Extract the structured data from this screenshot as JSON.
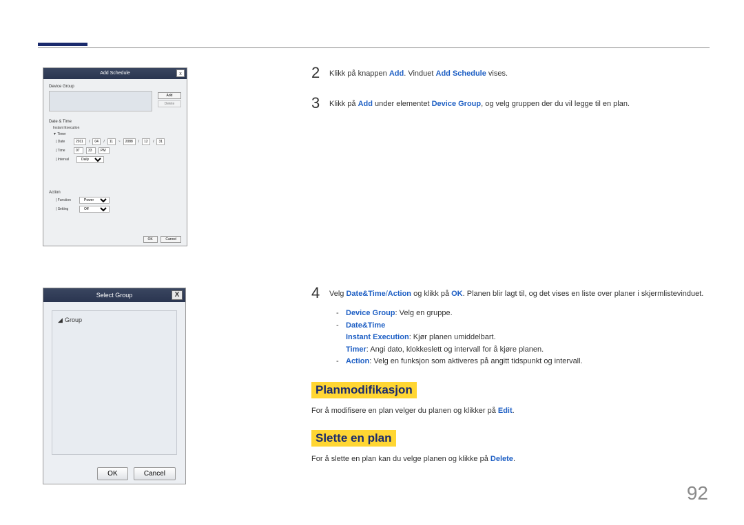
{
  "topAccent": "",
  "screenshot1": {
    "title": "Add Schedule",
    "close": "x",
    "deviceGroupLabel": "Device Group",
    "addBtn": "Add",
    "deleteBtn": "Delete",
    "dateTimeLabel": "Date & Time",
    "instantExec": "Instant Execution",
    "timerLabel": "Timer",
    "dateLabel": "Date",
    "dateVal1": "2011",
    "dateVal2": "04",
    "dateVal3": "11",
    "dateTo": "~",
    "dateVal4": "2088",
    "dateVal5": "12",
    "dateVal6": "31",
    "timeLabel": "Time",
    "timeVal1": "07",
    "timeVal2": "33",
    "timeAmPm": "PM",
    "intervalLabel": "Interval",
    "intervalVal": "Daily",
    "actionLabel": "Action",
    "functionLabel": "Function",
    "functionVal": "Power",
    "settingLabel": "Setting",
    "settingVal": "Off",
    "okBtn": "OK",
    "cancelBtn": "Cancel"
  },
  "screenshot2": {
    "title": "Select Group",
    "close": "X",
    "groupLabel": "Group",
    "okBtn": "OK",
    "cancelBtn": "Cancel"
  },
  "steps": {
    "s2": {
      "num": "2",
      "pre": "Klikk på knappen ",
      "b1": "Add",
      "mid": ". Vinduet ",
      "b2": "Add Schedule",
      "post": " vises."
    },
    "s3": {
      "num": "3",
      "pre": "Klikk på ",
      "b1": "Add",
      "mid": " under elementet ",
      "b2": "Device Group",
      "post": ", og velg gruppen der du vil legge til en plan."
    },
    "s4": {
      "num": "4",
      "pre": "Velg ",
      "b1": "Date&Time",
      "slash": "/",
      "b2": "Action",
      "mid": " og klikk på ",
      "b3": "OK",
      "post": ". Planen blir lagt til, og det vises en liste over planer i skjermlistevinduet."
    }
  },
  "subs": {
    "dg": {
      "label": "Device Group",
      "text": ": Velg en gruppe."
    },
    "dt": {
      "label": "Date&Time"
    },
    "ie": {
      "label": "Instant Execution",
      "text": ": Kjør planen umiddelbart."
    },
    "tm": {
      "label": "Timer",
      "text": ": Angi dato, klokkeslett og intervall for å kjøre planen."
    },
    "ac": {
      "label": "Action",
      "text": ": Velg en funksjon som aktiveres på angitt tidspunkt og intervall."
    }
  },
  "sections": {
    "mod": {
      "title": "Planmodifikasjon",
      "pre": "For å modifisere en plan velger du planen og klikker på ",
      "b": "Edit",
      "post": "."
    },
    "del": {
      "title": "Slette en plan",
      "pre": "For å slette en plan kan du velge planen og klikke på ",
      "b": "Delete",
      "post": "."
    }
  },
  "pageNum": "92"
}
